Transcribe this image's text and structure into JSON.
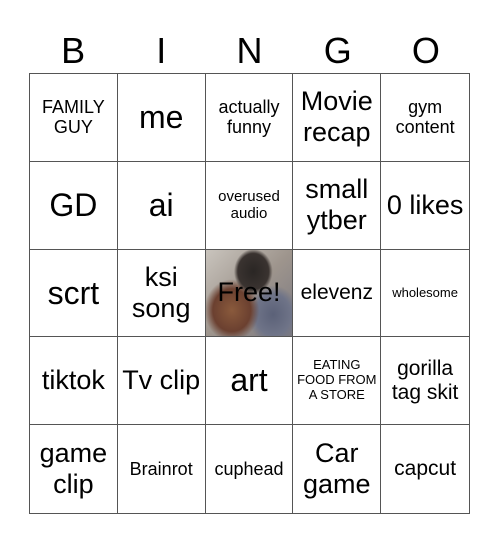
{
  "header": [
    "B",
    "I",
    "N",
    "G",
    "O"
  ],
  "cells": [
    {
      "text": "FAMILY GUY",
      "size": "s-sm"
    },
    {
      "text": "me",
      "size": "s-xl"
    },
    {
      "text": "actually funny",
      "size": "s-sm"
    },
    {
      "text": "Movie recap",
      "size": "s-lg"
    },
    {
      "text": "gym content",
      "size": "s-sm"
    },
    {
      "text": "GD",
      "size": "s-xl"
    },
    {
      "text": "ai",
      "size": "s-xl"
    },
    {
      "text": "overused audio",
      "size": "s-xs"
    },
    {
      "text": "small ytber",
      "size": "s-lg"
    },
    {
      "text": "0 likes",
      "size": "s-lg"
    },
    {
      "text": "scrt",
      "size": "s-xl"
    },
    {
      "text": "ksi song",
      "size": "s-lg"
    },
    {
      "text": "Free!",
      "size": "free",
      "free": true,
      "image": "photo-background"
    },
    {
      "text": "elevenz",
      "size": "s-md"
    },
    {
      "text": "wholesome",
      "size": "s-xxs"
    },
    {
      "text": "tiktok",
      "size": "s-lg"
    },
    {
      "text": "Tv clip",
      "size": "s-lg"
    },
    {
      "text": "art",
      "size": "s-xl"
    },
    {
      "text": "EATING FOOD FROM A STORE",
      "size": "s-xxs"
    },
    {
      "text": "gorilla tag skit",
      "size": "s-md"
    },
    {
      "text": "game clip",
      "size": "s-lg"
    },
    {
      "text": "Brainrot",
      "size": "s-sm"
    },
    {
      "text": "cuphead",
      "size": "s-sm"
    },
    {
      "text": "Car game",
      "size": "s-lg"
    },
    {
      "text": "capcut",
      "size": "s-md"
    }
  ]
}
